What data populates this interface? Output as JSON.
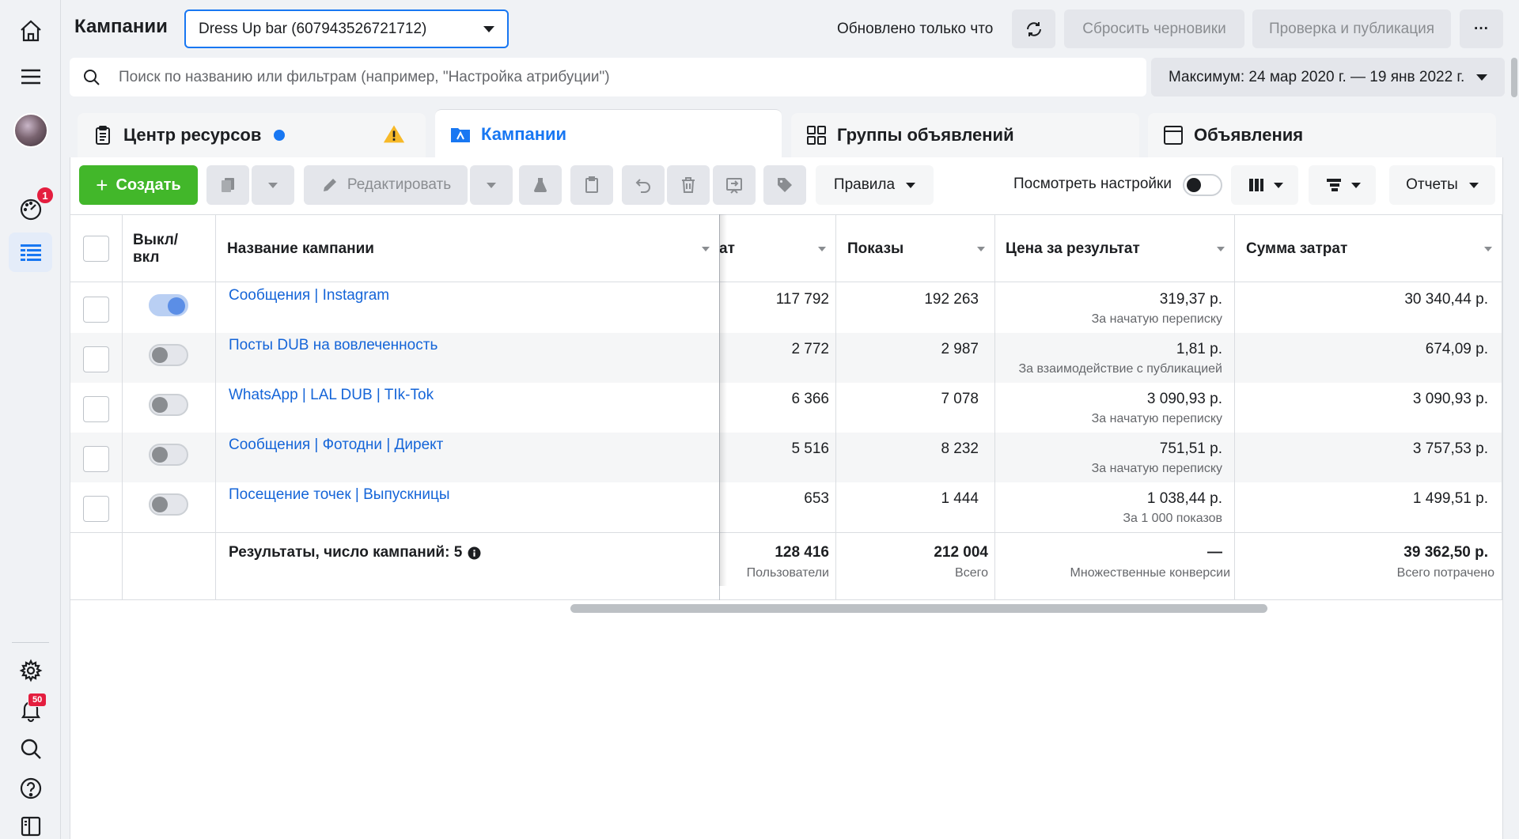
{
  "header": {
    "title": "Кампании",
    "account": "Dress Up bar (607943526721712)",
    "updated": "Обновлено только что",
    "reset_drafts": "Сбросить черновики",
    "review_publish": "Проверка и публикация",
    "more": "···"
  },
  "search": {
    "placeholder": "Поиск по названию или фильтрам (например, \"Настройка атрибуции\")",
    "date_range": "Максимум: 24 мар 2020 г. — 19 янв 2022 г."
  },
  "rail": {
    "notifications_badge": "1",
    "alerts_badge": "50"
  },
  "tabs": [
    {
      "label": "Центр ресурсов"
    },
    {
      "label": "Кампании"
    },
    {
      "label": "Группы объявлений"
    },
    {
      "label": "Объявления"
    }
  ],
  "toolbar": {
    "create": "Создать",
    "edit": "Редактировать",
    "rules": "Правила",
    "view_settings": "Посмотреть настройки",
    "reports": "Отчеты"
  },
  "table": {
    "headers": {
      "toggle": "Выкл/ вкл",
      "name": "Название кампании",
      "results": "ат",
      "impressions": "Показы",
      "cost_per_result": "Цена за результат",
      "spend": "Сумма затрат"
    },
    "rows": [
      {
        "name": "Сообщения | Instagram",
        "on": true,
        "results": "117 792",
        "impressions": "192 263",
        "cpr": "319,37 р.",
        "cpr_note": "За начатую переписку",
        "spend": "30 340,44 р."
      },
      {
        "name": "Посты DUB на вовлеченность",
        "on": false,
        "results": "2 772",
        "impressions": "2 987",
        "cpr": "1,81 р.",
        "cpr_note": "За взаимодействие с публикацией",
        "spend": "674,09 р."
      },
      {
        "name": "WhatsApp | LAL DUB | TIk-Tok",
        "on": false,
        "results": "6 366",
        "impressions": "7 078",
        "cpr": "3 090,93 р.",
        "cpr_note": "За начатую переписку",
        "spend": "3 090,93 р."
      },
      {
        "name": "Сообщения | Фотодни | Директ",
        "on": false,
        "results": "5 516",
        "impressions": "8 232",
        "cpr": "751,51 р.",
        "cpr_note": "За начатую переписку",
        "spend": "3 757,53 р."
      },
      {
        "name": "Посещение точек | Выпускницы",
        "on": false,
        "results": "653",
        "impressions": "1 444",
        "cpr": "1 038,44 р.",
        "cpr_note": "За 1 000 показов",
        "spend": "1 499,51 р."
      }
    ],
    "totals": {
      "label": "Результаты, число кампаний: 5",
      "results": "128 416",
      "results_note": "Пользователи",
      "impressions": "212 004",
      "impressions_note": "Всего",
      "cpr": "—",
      "cpr_note": "Множественные конверсии",
      "spend": "39 362,50 р.",
      "spend_note": "Всего потрачено"
    }
  },
  "colors": {
    "brand_blue": "#1877f2",
    "create_green": "#42b72a",
    "link": "#1565d8",
    "badge_red": "#e41e3f"
  }
}
